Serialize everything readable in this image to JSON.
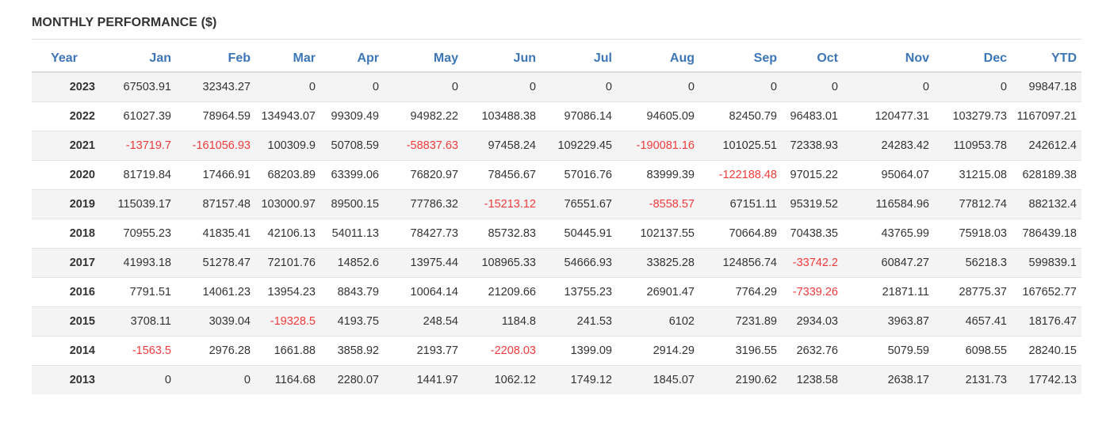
{
  "section_title": "MONTHLY PERFORMANCE ($)",
  "colors": {
    "header_text": "#3d76b7",
    "negative_text": "#ef3b3b",
    "stripe": "#f4f4f4"
  },
  "table": {
    "headers": [
      "Year",
      "Jan",
      "Feb",
      "Mar",
      "Apr",
      "May",
      "Jun",
      "Jul",
      "Aug",
      "Sep",
      "Oct",
      "Nov",
      "Dec",
      "YTD"
    ],
    "rows": [
      [
        "2023",
        "67503.91",
        "32343.27",
        "0",
        "0",
        "0",
        "0",
        "0",
        "0",
        "0",
        "0",
        "0",
        "0",
        "99847.18"
      ],
      [
        "2022",
        "61027.39",
        "78964.59",
        "134943.07",
        "99309.49",
        "94982.22",
        "103488.38",
        "97086.14",
        "94605.09",
        "82450.79",
        "96483.01",
        "120477.31",
        "103279.73",
        "1167097.21"
      ],
      [
        "2021",
        "-13719.7",
        "-161056.93",
        "100309.9",
        "50708.59",
        "-58837.63",
        "97458.24",
        "109229.45",
        "-190081.16",
        "101025.51",
        "72338.93",
        "24283.42",
        "110953.78",
        "242612.4"
      ],
      [
        "2020",
        "81719.84",
        "17466.91",
        "68203.89",
        "63399.06",
        "76820.97",
        "78456.67",
        "57016.76",
        "83999.39",
        "-122188.48",
        "97015.22",
        "95064.07",
        "31215.08",
        "628189.38"
      ],
      [
        "2019",
        "115039.17",
        "87157.48",
        "103000.97",
        "89500.15",
        "77786.32",
        "-15213.12",
        "76551.67",
        "-8558.57",
        "67151.11",
        "95319.52",
        "116584.96",
        "77812.74",
        "882132.4"
      ],
      [
        "2018",
        "70955.23",
        "41835.41",
        "42106.13",
        "54011.13",
        "78427.73",
        "85732.83",
        "50445.91",
        "102137.55",
        "70664.89",
        "70438.35",
        "43765.99",
        "75918.03",
        "786439.18"
      ],
      [
        "2017",
        "41993.18",
        "51278.47",
        "72101.76",
        "14852.6",
        "13975.44",
        "108965.33",
        "54666.93",
        "33825.28",
        "124856.74",
        "-33742.2",
        "60847.27",
        "56218.3",
        "599839.1"
      ],
      [
        "2016",
        "7791.51",
        "14061.23",
        "13954.23",
        "8843.79",
        "10064.14",
        "21209.66",
        "13755.23",
        "26901.47",
        "7764.29",
        "-7339.26",
        "21871.11",
        "28775.37",
        "167652.77"
      ],
      [
        "2015",
        "3708.11",
        "3039.04",
        "-19328.5",
        "4193.75",
        "248.54",
        "1184.8",
        "241.53",
        "6102",
        "7231.89",
        "2934.03",
        "3963.87",
        "4657.41",
        "18176.47"
      ],
      [
        "2014",
        "-1563.5",
        "2976.28",
        "1661.88",
        "3858.92",
        "2193.77",
        "-2208.03",
        "1399.09",
        "2914.29",
        "3196.55",
        "2632.76",
        "5079.59",
        "6098.55",
        "28240.15"
      ],
      [
        "2013",
        "0",
        "0",
        "1164.68",
        "2280.07",
        "1441.97",
        "1062.12",
        "1749.12",
        "1845.07",
        "2190.62",
        "1238.58",
        "2638.17",
        "2131.73",
        "17742.13"
      ]
    ]
  }
}
